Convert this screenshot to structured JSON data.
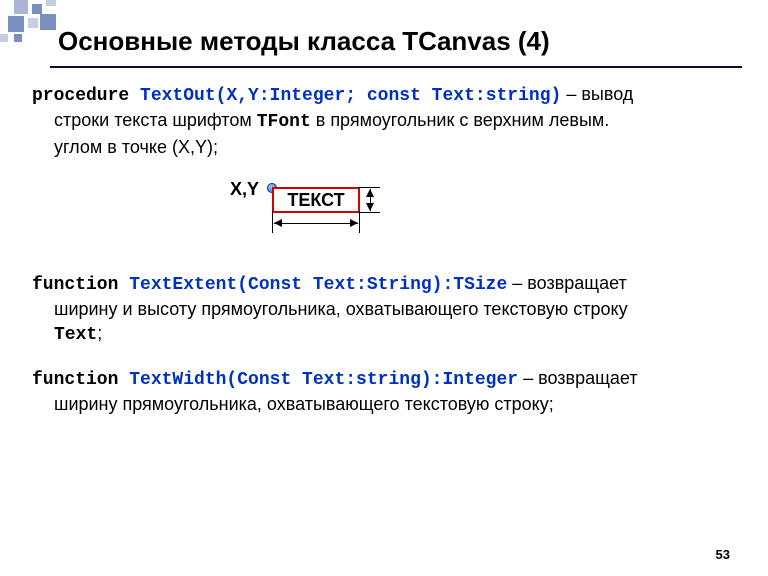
{
  "title": "Основные методы класса TCanvas (4)",
  "page_number": "53",
  "diagram": {
    "xy_label": "X,Y",
    "rect_text": "ТЕКСТ"
  },
  "para1": {
    "kw": "procedure ",
    "sig": "TextOut(X,Y:Integer; const Text:string)",
    "dash": " – ",
    "tail1": "вывод",
    "indent_a": "строки текста шрифтом ",
    "mono_tfont": "TFont",
    "indent_b": "  в прямоугольник с верхним левым.",
    "indent_c": "углом в точке (X,Y);"
  },
  "para2": {
    "kw": "function ",
    "sig": "TextExtent(Const Text:String):TSize",
    "dash": " – ",
    "tail1": "возвращает",
    "indent_a": "ширину и высоту прямоугольника, охватывающего текстовую строку",
    "mono_text": "Text",
    "semi": ";"
  },
  "para3": {
    "kw": "function ",
    "sig": "TextWidth(Const Text:string):Integer",
    "dash": " – ",
    "tail1": "возвращает",
    "indent_a": "ширину прямоугольника, охватывающего текстовую строку;"
  }
}
